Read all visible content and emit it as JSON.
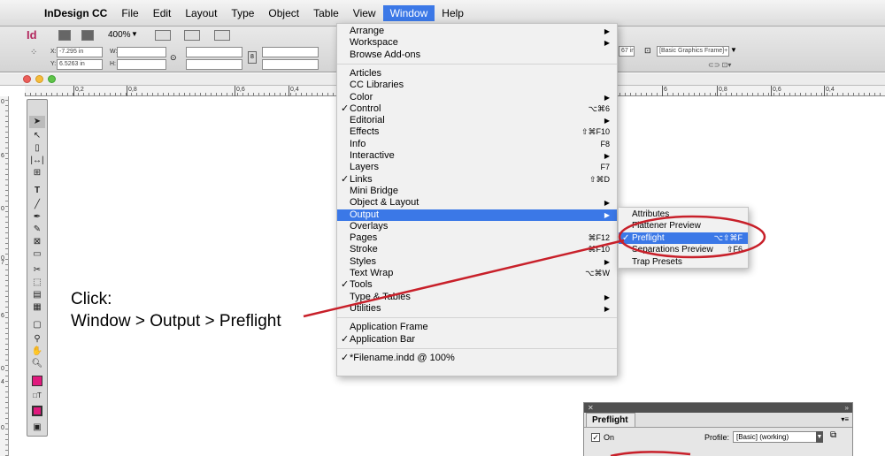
{
  "menubar": {
    "app": "InDesign CC",
    "items": [
      "File",
      "Edit",
      "Layout",
      "Type",
      "Object",
      "Table",
      "View",
      "Window",
      "Help"
    ],
    "active": "Window"
  },
  "control": {
    "app_icon": "Id",
    "zoom": "400%",
    "x_label": "X:",
    "x_value": "-7.295 in",
    "y_label": "Y:",
    "y_value": "6.5263 in",
    "w_label": "W:",
    "h_label": "H:",
    "frame_style": "[Basic Graphics Frame]+",
    "right_value": "67 in"
  },
  "ruler": {
    "labels": [
      "0,2",
      "0,8",
      "0,6",
      "0,4",
      "6",
      "0,8",
      "0,6",
      "0,4"
    ]
  },
  "vruler": {
    "labels": [
      "0",
      "6",
      "0",
      "0",
      "7",
      "6",
      "0",
      "4",
      "0"
    ]
  },
  "window_menu": {
    "items": [
      {
        "label": "Arrange",
        "submenu": true
      },
      {
        "label": "Workspace",
        "submenu": true
      },
      {
        "label": "Browse Add-ons"
      },
      {
        "sep": true
      },
      {
        "label": "Articles"
      },
      {
        "label": "CC Libraries"
      },
      {
        "label": "Color",
        "submenu": true
      },
      {
        "label": "Control",
        "checked": true,
        "shortcut": "⌥⌘6"
      },
      {
        "label": "Editorial",
        "submenu": true
      },
      {
        "label": "Effects",
        "shortcut": "⇧⌘F10"
      },
      {
        "label": "Info",
        "shortcut": "F8"
      },
      {
        "label": "Interactive",
        "submenu": true
      },
      {
        "label": "Layers",
        "shortcut": "F7"
      },
      {
        "label": "Links",
        "checked": true,
        "shortcut": "⇧⌘D"
      },
      {
        "label": "Mini Bridge"
      },
      {
        "label": "Object & Layout",
        "submenu": true
      },
      {
        "label": "Output",
        "submenu": true,
        "highlighted": true
      },
      {
        "label": "Overlays"
      },
      {
        "label": "Pages",
        "shortcut": "⌘F12"
      },
      {
        "label": "Stroke",
        "shortcut": "⌘F10"
      },
      {
        "label": "Styles",
        "submenu": true
      },
      {
        "label": "Text Wrap",
        "shortcut": "⌥⌘W"
      },
      {
        "label": "Tools",
        "checked": true
      },
      {
        "label": "Type & Tables",
        "submenu": true
      },
      {
        "label": "Utilities",
        "submenu": true
      },
      {
        "sep": true
      },
      {
        "label": "Application Frame"
      },
      {
        "label": "Application Bar",
        "checked": true
      },
      {
        "sep": true
      },
      {
        "label": "*Filename.indd @ 100%",
        "checked": true
      }
    ]
  },
  "output_submenu": {
    "items": [
      {
        "label": "Attributes"
      },
      {
        "label": "Flattener Preview"
      },
      {
        "label": "Preflight",
        "checked": true,
        "highlighted": true,
        "shortcut": "⌥⇧⌘F"
      },
      {
        "label": "Separations Preview",
        "shortcut": "⇧F6"
      },
      {
        "label": "Trap Presets"
      }
    ]
  },
  "annotation": {
    "line1": "Click:",
    "line2": "Window > Output > Preflight",
    "color": "#c8202a"
  },
  "preflight_panel": {
    "tab": "Preflight",
    "on_label": "On",
    "profile_label": "Profile:",
    "profile_value": "[Basic] (working)"
  },
  "colors": {
    "highlight": "#3b78e7",
    "swatch_fill": "#e0197d"
  }
}
